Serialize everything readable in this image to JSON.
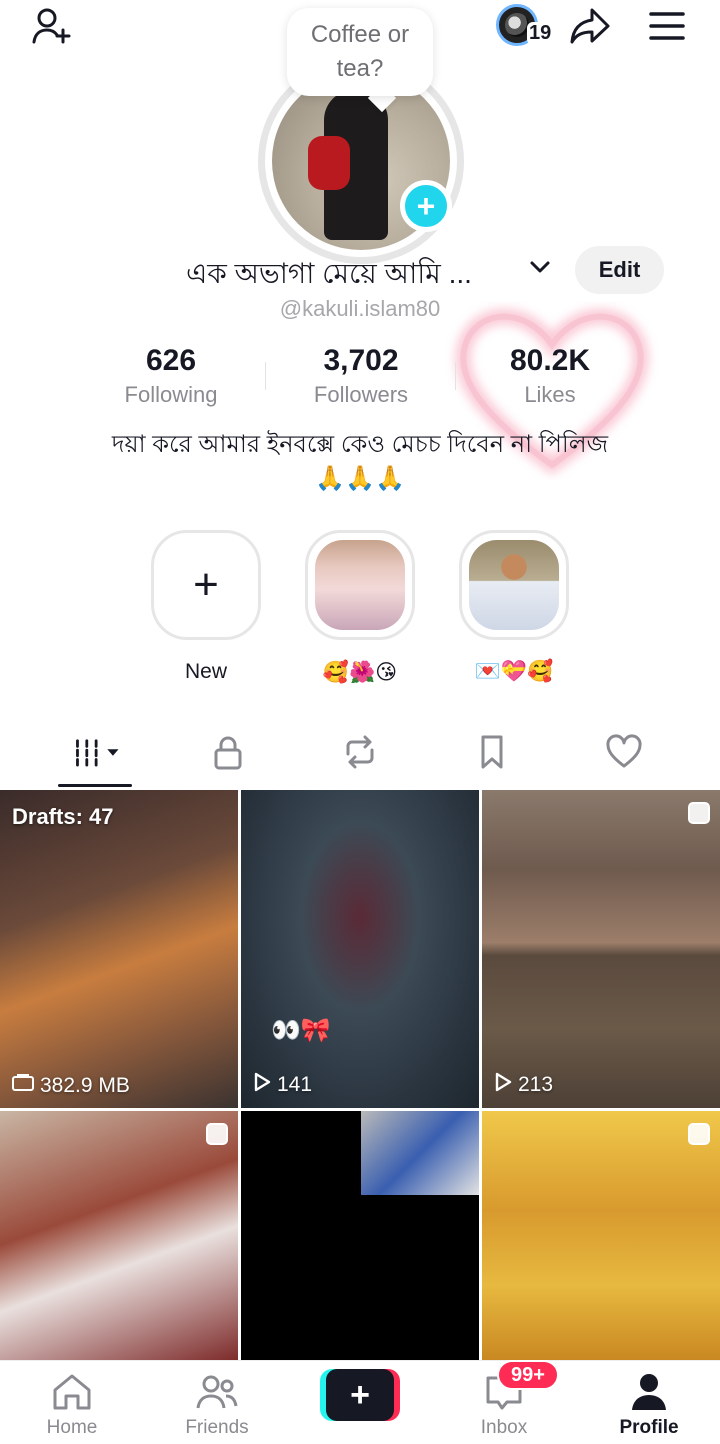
{
  "header": {
    "friend_count": "19"
  },
  "note": {
    "text": "Coffee or tea?"
  },
  "profile": {
    "display_name": "এক অভাগা মেয়ে  আমি ...",
    "edit_label": "Edit",
    "username": "@kakuli.islam80",
    "bio_line1": "দয়া করে আমার ইনবক্সে  কেও মেচচ দিবেন না পিলিজ",
    "bio_line2": "🙏🙏🙏"
  },
  "stats": {
    "following": {
      "value": "626",
      "label": "Following"
    },
    "followers": {
      "value": "3,702",
      "label": "Followers"
    },
    "likes": {
      "value": "80.2K",
      "label": "Likes"
    }
  },
  "highlights": [
    {
      "label": "New"
    },
    {
      "label": "🥰🌺😘"
    },
    {
      "label": "💌💝🥰"
    }
  ],
  "tabs": [
    {
      "icon": "grid-icon"
    },
    {
      "icon": "lock-icon"
    },
    {
      "icon": "repost-icon"
    },
    {
      "icon": "bookmark-icon"
    },
    {
      "icon": "heart-icon"
    }
  ],
  "videos": [
    {
      "drafts": "Drafts: 47",
      "label": "382.9 MB"
    },
    {
      "label": "141",
      "emoji": "👀🎀"
    },
    {
      "label": "213"
    },
    {
      "label": ""
    },
    {
      "label": ""
    },
    {
      "label": ""
    }
  ],
  "bottom_nav": {
    "home": "Home",
    "friends": "Friends",
    "inbox": "Inbox",
    "inbox_badge": "99+",
    "profile": "Profile"
  },
  "colors": {
    "accent_cyan": "#20d5ec",
    "accent_red": "#fe2c55",
    "text_primary": "#161823",
    "text_secondary": "#8a8b91"
  }
}
